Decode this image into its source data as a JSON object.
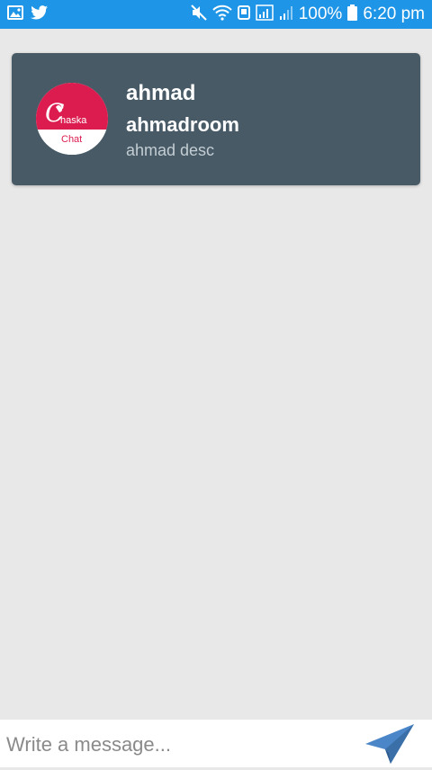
{
  "status_bar": {
    "left_icons": [
      "gallery-icon",
      "twitter-icon"
    ],
    "right_icons": [
      "mute-icon",
      "wifi-icon",
      "nfc-icon",
      "sim-signal-icon",
      "signal-icon",
      "battery-icon"
    ],
    "battery": "100%",
    "time": "6:20 pm"
  },
  "room_card": {
    "title": "ahmad",
    "room_name": "ahmadroom",
    "description": "ahmad desc",
    "avatar": {
      "brand_text": "haska",
      "label": "Chat"
    }
  },
  "composer": {
    "placeholder": "Write a message...",
    "value": ""
  },
  "colors": {
    "status_bar": "#1e95e6",
    "card_background": "#475a66",
    "page_background": "#e8e8e8",
    "avatar_red": "#dc1c4f",
    "send_icon": "#4a86c8"
  }
}
